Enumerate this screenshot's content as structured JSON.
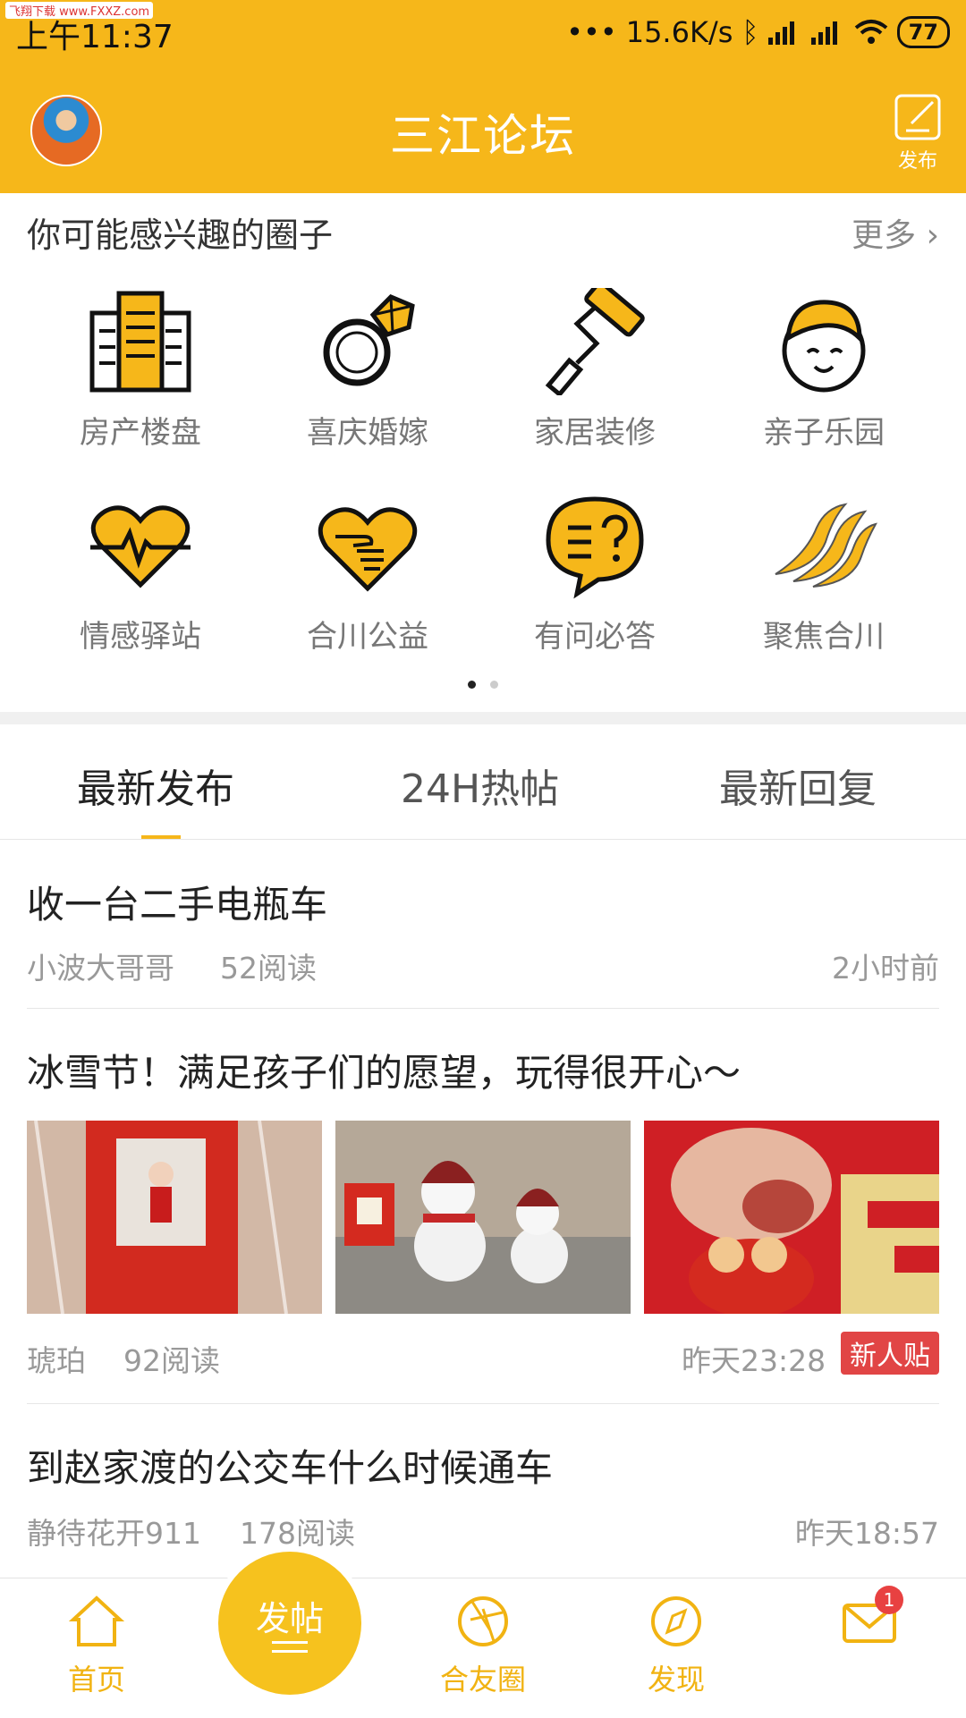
{
  "status_bar": {
    "time": "上午11:37",
    "speed": "15.6K/s",
    "battery": "77",
    "watermark": "飞翔下载 www.FXXZ.com"
  },
  "app": {
    "title": "三江论坛",
    "publish_label": "发布"
  },
  "circles": {
    "heading": "你可能感兴趣的圈子",
    "more": "更多",
    "items": [
      {
        "label": "房产楼盘",
        "icon": "building-icon"
      },
      {
        "label": "喜庆婚嫁",
        "icon": "ring-icon"
      },
      {
        "label": "家居装修",
        "icon": "paint-roller-icon"
      },
      {
        "label": "亲子乐园",
        "icon": "child-face-icon"
      },
      {
        "label": "情感驿站",
        "icon": "heartbeat-icon"
      },
      {
        "label": "合川公益",
        "icon": "heart-hand-icon"
      },
      {
        "label": "有问必答",
        "icon": "question-bubble-icon"
      },
      {
        "label": "聚焦合川",
        "icon": "wave-logo-icon"
      }
    ]
  },
  "tabs": [
    "最新发布",
    "24H热帖",
    "最新回复"
  ],
  "posts": [
    {
      "title": "收一台二手电瓶车",
      "author": "小波大哥哥",
      "reads": "52阅读",
      "time": "2小时前"
    },
    {
      "title": "冰雪节！满足孩子们的愿望，玩得很开心～",
      "author": "琥珀",
      "reads": "92阅读",
      "time": "昨天23:28",
      "badge": "新人贴"
    },
    {
      "title": "到赵家渡的公交车什么时候通车",
      "author": "静待花开911",
      "reads": "178阅读",
      "time": "昨天18:57"
    }
  ],
  "bottom_nav": {
    "home": "首页",
    "post_button": "发帖",
    "friends": "合友圈",
    "discover": "发现",
    "messages_badge": "1"
  },
  "colors": {
    "accent": "#f6b71a",
    "badge_red": "#e14545"
  }
}
